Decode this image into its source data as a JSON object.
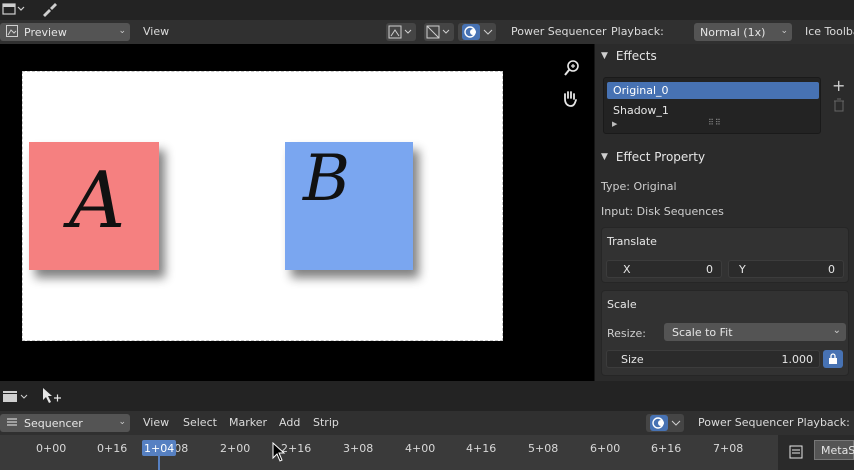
{
  "preview_header": {
    "editor_type": "Preview",
    "view_menu": "View",
    "power_sequencer": "Power Sequencer",
    "playback_label": "Playback:",
    "playback_value": "Normal (1x)",
    "ice_toolbar": "Ice Toolba"
  },
  "canvas": {
    "card_a": {
      "letter": "A",
      "color": "#f58080"
    },
    "card_b": {
      "letter": "B",
      "color": "#7aa6f0"
    }
  },
  "panel": {
    "effects_title": "Effects",
    "effects_items": [
      "Original_0",
      "Shadow_1"
    ],
    "effect_property_title": "Effect Property",
    "type_text": "Type: Original",
    "input_text": "Input: Disk Sequences",
    "translate": {
      "title": "Translate",
      "x_label": "X",
      "x_value": "0",
      "y_label": "Y",
      "y_value": "0"
    },
    "scale": {
      "title": "Scale",
      "resize_label": "Resize:",
      "resize_value": "Scale to Fit",
      "size_label": "Size",
      "size_value": "1.000"
    }
  },
  "sequencer_header": {
    "editor_type": "Sequencer",
    "menus": [
      "View",
      "Select",
      "Marker",
      "Add",
      "Strip"
    ],
    "power_sequencer": "Power Sequencer",
    "playback_label": "Playback:"
  },
  "timeline": {
    "ticks": [
      "0+00",
      "0+16",
      "1+08",
      "2+00",
      "2+16",
      "3+08",
      "4+00",
      "4+16",
      "5+08",
      "6+00",
      "6+16",
      "7+08"
    ],
    "playhead": "1+04",
    "meta_strip": "MetaS"
  },
  "colors": {
    "selection": "#5680c2",
    "accent_blue": "#4772b3"
  }
}
